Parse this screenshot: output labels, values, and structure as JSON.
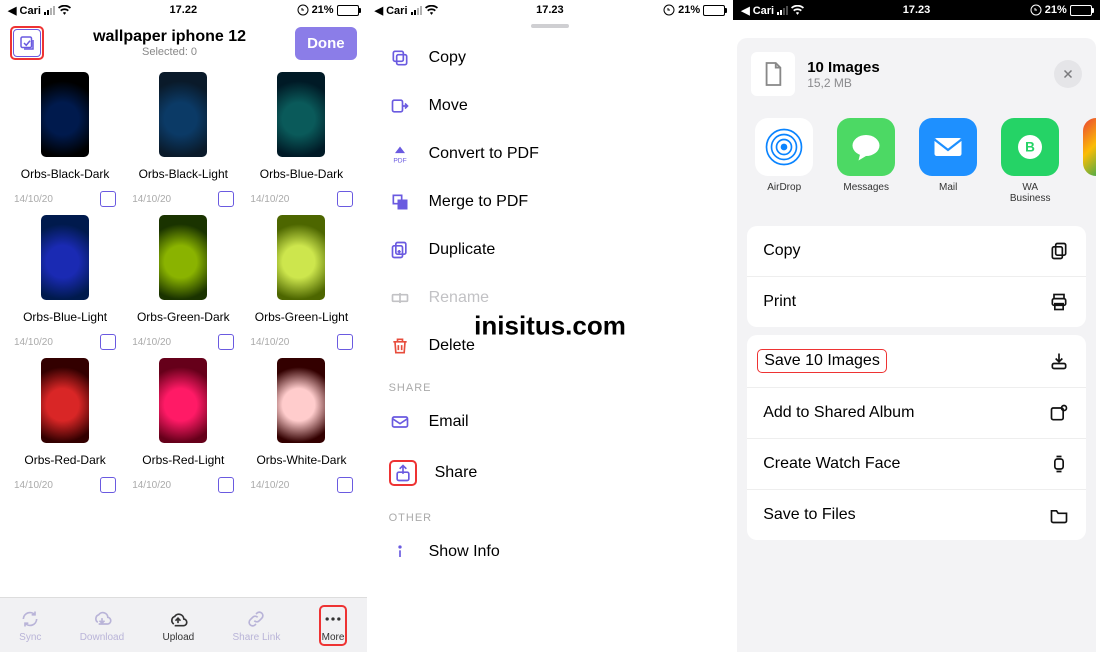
{
  "status": {
    "carrier_back": "◀ Cari",
    "time1": "17.22",
    "time2": "17.23",
    "time3": "17.23",
    "battery_pct": "21%"
  },
  "panel1": {
    "title": "wallpaper iphone 12",
    "selected": "Selected: 0",
    "done": "Done",
    "date": "14/10/20",
    "items": [
      {
        "name": "Orbs-Black-Dark",
        "cls": "o-black-dark"
      },
      {
        "name": "Orbs-Black-Light",
        "cls": "o-black-light"
      },
      {
        "name": "Orbs-Blue-Dark",
        "cls": "o-blue-dark"
      },
      {
        "name": "Orbs-Blue-Light",
        "cls": "o-blue-light"
      },
      {
        "name": "Orbs-Green-Dark",
        "cls": "o-green-dark"
      },
      {
        "name": "Orbs-Green-Light",
        "cls": "o-green-light"
      },
      {
        "name": "Orbs-Red-Dark",
        "cls": "o-red-dark"
      },
      {
        "name": "Orbs-Red-Light",
        "cls": "o-red-light"
      },
      {
        "name": "Orbs-White-Dark",
        "cls": "o-white-dark"
      }
    ],
    "toolbar": {
      "sync": "Sync",
      "download": "Download",
      "upload": "Upload",
      "sharelink": "Share Link",
      "more": "More"
    }
  },
  "panel2": {
    "copy": "Copy",
    "move": "Move",
    "pdf": "Convert to PDF",
    "merge": "Merge to PDF",
    "dup": "Duplicate",
    "rename": "Rename",
    "delete": "Delete",
    "share_section": "SHARE",
    "email": "Email",
    "share": "Share",
    "other_section": "OTHER",
    "info": "Show Info"
  },
  "watermark": "inisitus.com",
  "panel3": {
    "title": "10 Images",
    "size": "15,2 MB",
    "apps": {
      "airdrop": "AirDrop",
      "messages": "Messages",
      "mail": "Mail",
      "wa": "WA Business"
    },
    "copy": "Copy",
    "print": "Print",
    "save": "Save 10 Images",
    "shared": "Add to Shared Album",
    "watch": "Create Watch Face",
    "files": "Save to Files"
  }
}
